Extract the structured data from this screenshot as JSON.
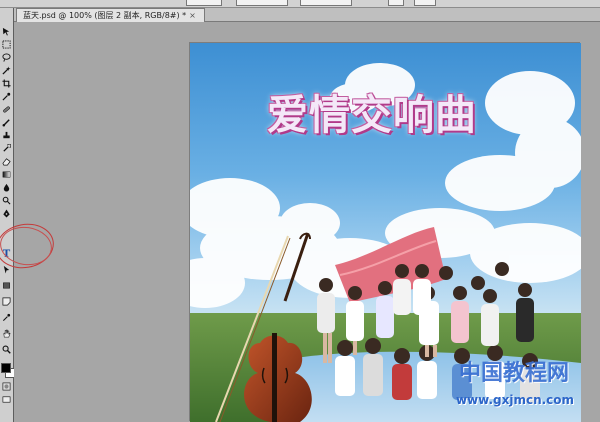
{
  "document": {
    "tab_title": "蓝天.psd @ 100% (图层 2 副本, RGB/8#) *",
    "close_symbol": "×"
  },
  "poster": {
    "title": "爱情交响曲"
  },
  "watermark": {
    "text": "中国教程网",
    "url": "www.gxjmcn.com"
  },
  "tools": [
    "move-tool",
    "marquee-tool",
    "lasso-tool",
    "magic-wand-tool",
    "crop-tool",
    "eyedropper-tool",
    "healing-brush-tool",
    "brush-tool",
    "clone-stamp-tool",
    "history-brush-tool",
    "eraser-tool",
    "gradient-tool",
    "blur-tool",
    "dodge-tool",
    "pen-tool",
    "type-tool",
    "path-selection-tool",
    "shape-tool",
    "notes-tool",
    "hand-tool",
    "zoom-tool"
  ],
  "type_tool_glyph": "T",
  "colors": {
    "foreground": "#000000",
    "background": "#ffffff",
    "annotation": "#c43b3b",
    "title_fill": "#f4e8f8",
    "title_outline": "#b13a8a"
  }
}
